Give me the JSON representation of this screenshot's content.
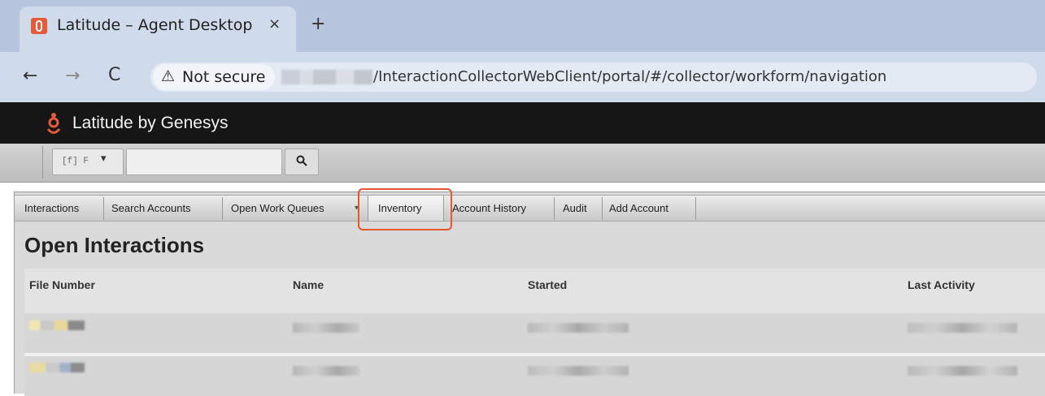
{
  "browser": {
    "tab_title": "Latitude – Agent Desktop",
    "tab_close": "×",
    "new_tab": "+",
    "nav": {
      "back": "←",
      "forward": "→",
      "reload": "C"
    },
    "security_icon": "⚠",
    "security_label": "Not secure",
    "url_path": "/InteractionCollectorWebClient/portal/#/collector/workform/navigation"
  },
  "app": {
    "brand": "Latitude by Genesys",
    "search": {
      "select_value": "[f] F",
      "select_arrow": "▾",
      "input_value": ""
    },
    "menu": {
      "items": [
        "Interactions",
        "Search Accounts",
        "Open Work Queues",
        "Inventory",
        "Account History",
        "Audit",
        "Add Account"
      ],
      "queues_arrow": "▾",
      "highlighted": "Inventory"
    },
    "page_title": "Open Interactions",
    "table": {
      "headers": [
        "File Number",
        "Name",
        "Started",
        "Last Activity"
      ]
    }
  },
  "colors": {
    "tabstrip": "#b7c6de",
    "addressbar": "#cfdaeb",
    "app_header": "#161616",
    "brand_accent": "#e55b3c",
    "highlight": "#e5572f"
  },
  "icons": {
    "favicon": "genesys-favicon",
    "logo": "genesys-logo-icon",
    "search": "search-icon",
    "warning": "warning-icon"
  }
}
